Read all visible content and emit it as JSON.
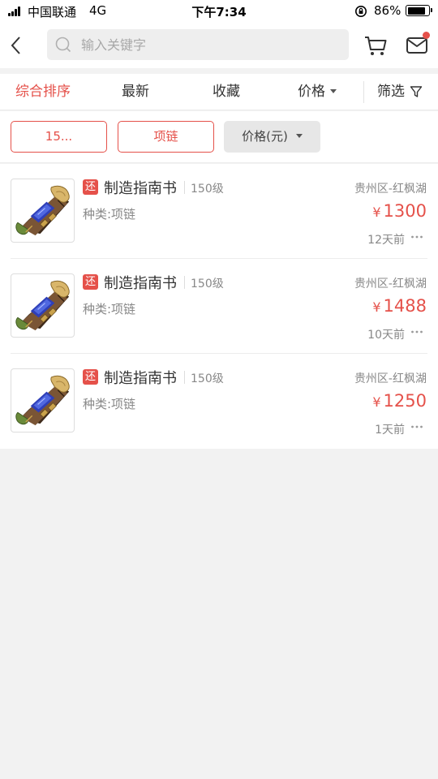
{
  "status_bar": {
    "carrier": "中国联通",
    "network": "4G",
    "time": "下午7:34",
    "battery": "86%",
    "battery_level": 0.86
  },
  "header": {
    "search_placeholder": "输入关键字",
    "icons": {
      "back": "chevron-left-icon",
      "search": "search-icon",
      "cart": "cart-icon",
      "mail": "mail-icon"
    }
  },
  "sort_bar": {
    "items": [
      {
        "label": "综合排序",
        "active": true
      },
      {
        "label": "最新",
        "active": false
      },
      {
        "label": "收藏",
        "active": false
      },
      {
        "label": "价格",
        "active": false
      },
      {
        "label": "筛选",
        "active": false
      }
    ]
  },
  "chips": [
    {
      "label": "15..."
    },
    {
      "label": "项链"
    },
    {
      "label": "价格(元)"
    }
  ],
  "items": [
    {
      "badge": "还",
      "title": "制造指南书",
      "level": "150级",
      "category": "种类:项链",
      "server": "贵州区-红枫湖",
      "currency": "¥",
      "price": "1300",
      "time": "12天前"
    },
    {
      "badge": "还",
      "title": "制造指南书",
      "level": "150级",
      "category": "种类:项链",
      "server": "贵州区-红枫湖",
      "currency": "¥",
      "price": "1488",
      "time": "10天前"
    },
    {
      "badge": "还",
      "title": "制造指南书",
      "level": "150级",
      "category": "种类:项链",
      "server": "贵州区-红枫湖",
      "currency": "¥",
      "price": "1250",
      "time": "1天前"
    }
  ],
  "colors": {
    "accent": "#e5514a",
    "background": "#f2f2f2"
  }
}
